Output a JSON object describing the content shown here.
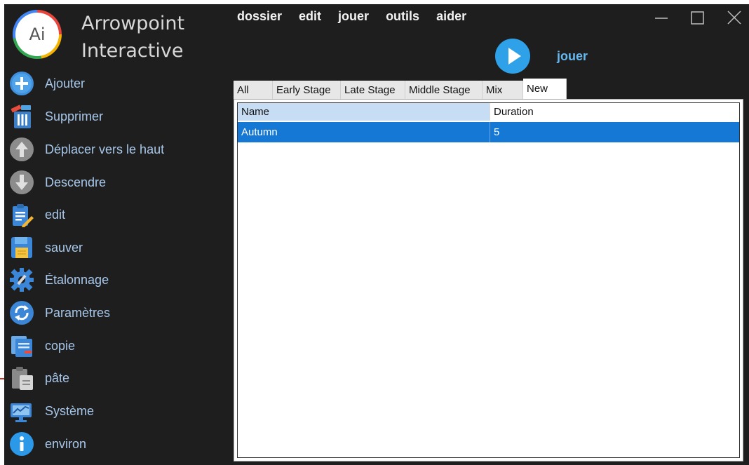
{
  "app": {
    "logo_text": "Ai",
    "brand_line1": "Arrowpoint",
    "brand_line2": "Interactive"
  },
  "menu": [
    "dossier",
    "edit",
    "jouer",
    "outils",
    "aider"
  ],
  "window_controls": [
    "minimize-icon",
    "maximize-icon",
    "close-icon"
  ],
  "sidebar": {
    "items": [
      {
        "label": "Ajouter",
        "icon": "add-icon"
      },
      {
        "label": "Supprimer",
        "icon": "trash-icon"
      },
      {
        "label": "Déplacer vers le haut",
        "icon": "arrow-up-icon"
      },
      {
        "label": "Descendre",
        "icon": "arrow-down-icon"
      },
      {
        "label": "edit",
        "icon": "edit-icon"
      },
      {
        "label": "sauver",
        "icon": "save-icon"
      },
      {
        "label": "Étalonnage",
        "icon": "calibration-gear-icon"
      },
      {
        "label": "Paramètres",
        "icon": "settings-refresh-icon"
      },
      {
        "label": "copie",
        "icon": "copy-icon"
      },
      {
        "label": "pâte",
        "icon": "paste-icon"
      },
      {
        "label": "Système",
        "icon": "system-icon"
      },
      {
        "label": "environ",
        "icon": "info-icon"
      }
    ]
  },
  "player": {
    "label": "jouer",
    "icon": "play-icon"
  },
  "tabs": [
    {
      "label": "All",
      "active": false
    },
    {
      "label": "Early Stage",
      "active": false
    },
    {
      "label": "Late Stage",
      "active": false
    },
    {
      "label": "Middle Stage",
      "active": false
    },
    {
      "label": "Mix",
      "active": false
    },
    {
      "label": "New",
      "active": true
    }
  ],
  "table": {
    "columns": [
      "Name",
      "Duration"
    ],
    "rows": [
      {
        "name": "Autumn",
        "duration": "5",
        "selected": true
      }
    ]
  },
  "colors": {
    "background": "#1e1e1e",
    "sidebar_text": "#a7c7ea",
    "accent_blue": "#2ea1e8",
    "selection": "#1478d4"
  }
}
